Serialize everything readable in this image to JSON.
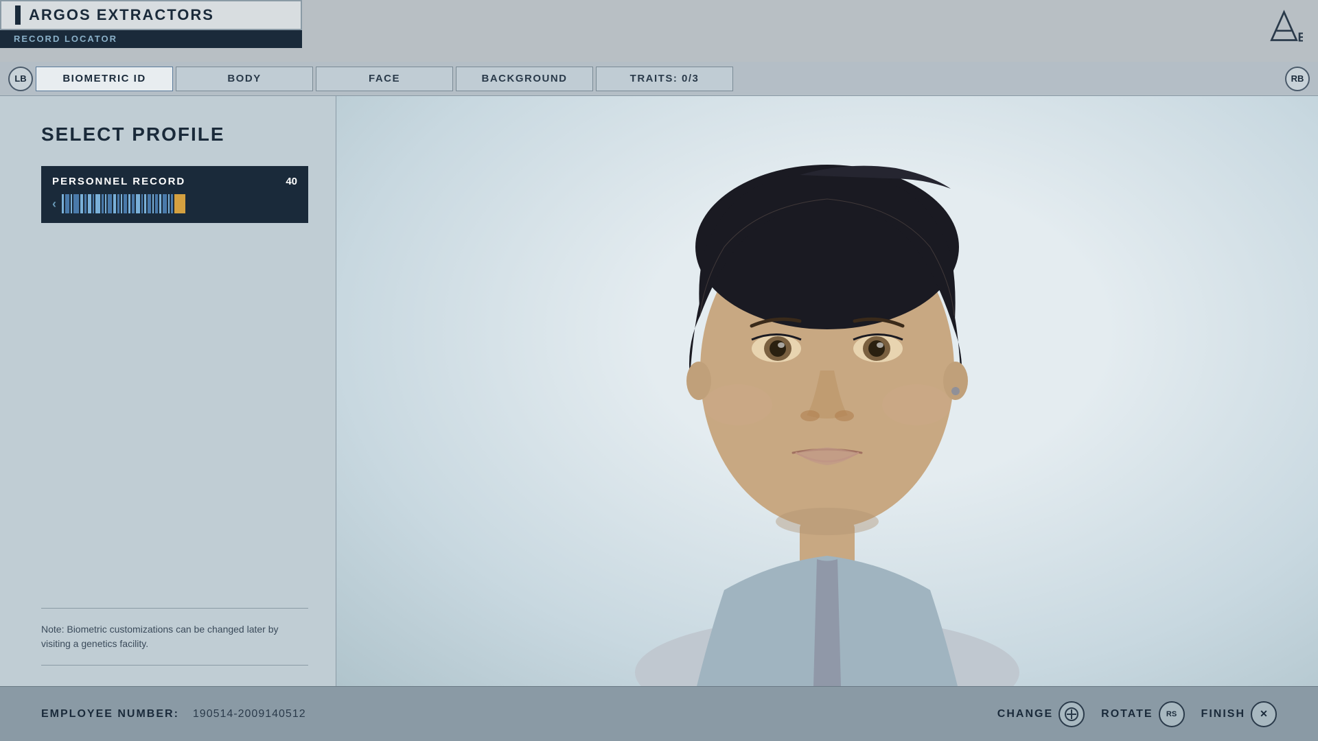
{
  "header": {
    "title": "ARGOS EXTRACTORS",
    "subtitle": "RECORD LOCATOR",
    "logo": "AE"
  },
  "nav": {
    "left_button": "LB",
    "right_button": "RB",
    "tabs": [
      {
        "label": "BIOMETRIC ID",
        "active": true
      },
      {
        "label": "BODY",
        "active": false
      },
      {
        "label": "FACE",
        "active": false
      },
      {
        "label": "BACKGROUND",
        "active": false
      },
      {
        "label": "TRAITS: 0/3",
        "active": false
      }
    ]
  },
  "left_panel": {
    "section_title": "SELECT PROFILE",
    "profile_card": {
      "title": "PERSONNEL RECORD",
      "number": "40",
      "arrow": "<"
    },
    "note": "Note: Biometric customizations can be changed later by visiting a genetics facility."
  },
  "bottom_bar": {
    "employee_label": "EMPLOYEE NUMBER:",
    "employee_number": "190514-2009140512",
    "actions": [
      {
        "label": "CHANGE",
        "button": "RS",
        "button_label": "⊕"
      },
      {
        "label": "ROTATE",
        "button": "RS",
        "button_label": "RS"
      },
      {
        "label": "FINISH",
        "button": "X",
        "button_label": "X"
      }
    ]
  }
}
